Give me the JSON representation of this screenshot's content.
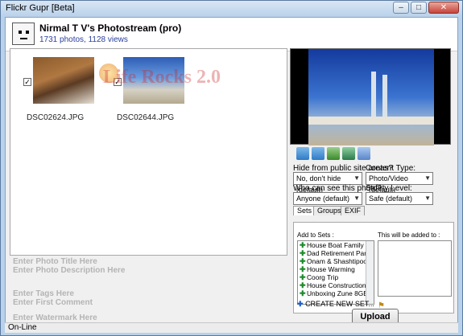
{
  "window": {
    "title": "Flickr Gupr [Beta]"
  },
  "header": {
    "name": "Nirmal T V's Photostream (pro)",
    "stats": "1731 photos, 1128 views"
  },
  "photos": [
    {
      "filename": "DSC02624.JPG",
      "checked": "✓"
    },
    {
      "filename": "DSC02644.JPG",
      "checked": "✓"
    }
  ],
  "watermark_overlay": "Life Rocks 2.0",
  "fields": {
    "photo_title_placeholder": "Enter Photo Title Here",
    "photo_description_placeholder": "Enter Photo Description Here",
    "tags_placeholder": "Enter Tags Here",
    "first_comment_placeholder": "Enter First Comment",
    "watermark_placeholder": "Enter Watermark Here"
  },
  "options": {
    "hide_label": "Hide from public site areas?",
    "hide_value": "No, don't hide (default)",
    "content_type_label": "Content Type:",
    "content_type_value": "Photo/Video (default)",
    "who_label": "Who can see this photo?",
    "who_value": "Anyone (default)",
    "safety_label": "Safety Level:",
    "safety_value": "Safe (default)"
  },
  "tabs": [
    "Sets",
    "Groups",
    "EXIF"
  ],
  "sets": {
    "add_label": "Add to Sets :",
    "added_label": "This will be added to :",
    "items": [
      "House Boat Family Get t",
      "Dad Retirement Party",
      "Onam & Shashtipoorthi",
      "House Warming",
      "Coorg Trip",
      "House Construction",
      "Unboxing Zune 8GB"
    ],
    "create_label": "CREATE NEW SET..."
  },
  "upload_label": "Upload",
  "status": "On-Line"
}
